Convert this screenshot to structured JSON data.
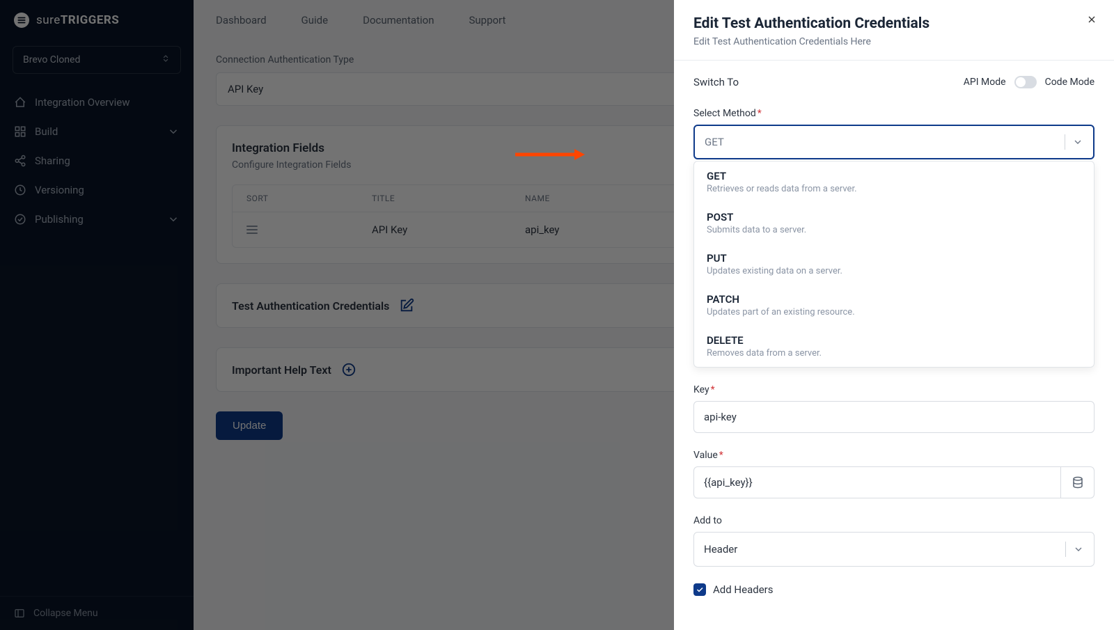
{
  "brand": {
    "name_light": "sure",
    "name_bold": "TRIGGERS"
  },
  "project": {
    "name": "Brevo Cloned"
  },
  "sidebar": {
    "items": [
      {
        "label": "Integration Overview",
        "icon": "home"
      },
      {
        "label": "Build",
        "icon": "grid",
        "expandable": true
      },
      {
        "label": "Sharing",
        "icon": "share"
      },
      {
        "label": "Versioning",
        "icon": "clock"
      },
      {
        "label": "Publishing",
        "icon": "check-circle",
        "expandable": true
      }
    ],
    "collapse_label": "Collapse Menu"
  },
  "topnav": {
    "items": [
      "Dashboard",
      "Guide",
      "Documentation",
      "Support"
    ]
  },
  "main": {
    "auth_type_label": "Connection Authentication Type",
    "auth_type_value": "API Key",
    "fields_card": {
      "title": "Integration Fields",
      "subtitle": "Configure Integration Fields",
      "columns": {
        "sort": "SORT",
        "title": "TITLE",
        "name": "NAME"
      },
      "row": {
        "title": "API Key",
        "name": "api_key"
      }
    },
    "test_auth_label": "Test Authentication Credentials",
    "help_text_label": "Important Help Text",
    "update_button": "Update"
  },
  "panel": {
    "title": "Edit Test Authentication Credentials",
    "subtitle": "Edit Test Authentication Credentials Here",
    "switch_to_label": "Switch To",
    "mode_left": "API Mode",
    "mode_right": "Code Mode",
    "select_method": {
      "label": "Select Method",
      "value": "GET",
      "options": [
        {
          "label": "GET",
          "desc": "Retrieves or reads data from a server."
        },
        {
          "label": "POST",
          "desc": "Submits data to a server."
        },
        {
          "label": "PUT",
          "desc": "Updates existing data on a server."
        },
        {
          "label": "PATCH",
          "desc": "Updates part of an existing resource."
        },
        {
          "label": "DELETE",
          "desc": "Removes data from a server."
        }
      ]
    },
    "key_field": {
      "label": "Key",
      "value": "api-key"
    },
    "value_field": {
      "label": "Value",
      "value": "{{api_key}}"
    },
    "addto_field": {
      "label": "Add to",
      "value": "Header"
    },
    "add_headers_label": "Add Headers"
  }
}
